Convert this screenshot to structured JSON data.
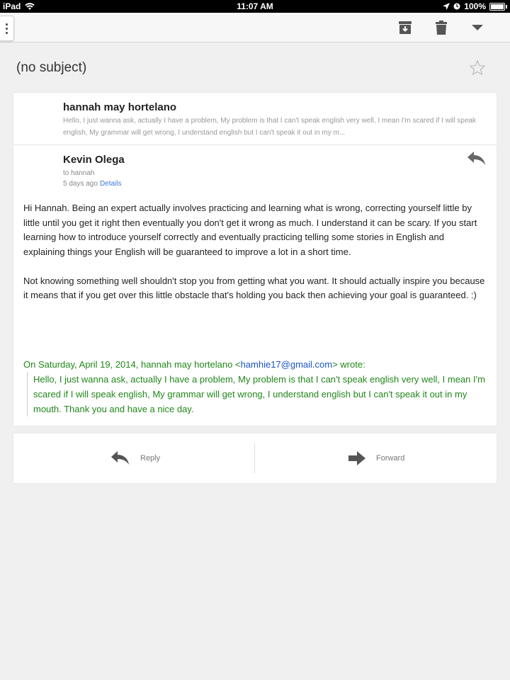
{
  "status_bar": {
    "device": "iPad",
    "time": "11:07 AM",
    "battery": "100%"
  },
  "toolbar": {
    "icons": [
      "menu-dots-icon",
      "archive-icon",
      "trash-icon",
      "chevron-down-icon"
    ]
  },
  "subject": "(no subject)",
  "thread": {
    "collapsed_message": {
      "sender": "hannah may hortelano",
      "snippet": "Hello, I just wanna ask, actually I have a problem, My problem is that I can't speak english very well, I mean I'm scared if I will speak english, My grammar will get wrong, I understand english but I can't speak it out in my m..."
    },
    "expanded_message": {
      "sender": "Kevin Olega",
      "to": "to hannah",
      "date": "5 days ago",
      "details_link": "Details",
      "body_p1": "Hi Hannah. Being an expert actually involves practicing and learning what is wrong, correcting yourself little by little until you get it right then eventually you don't get it wrong as much. I understand it can be scary. If you start learning how to introduce yourself correctly and eventually practicing telling some stories in English and explaining things your English will be guaranteed to improve a lot in a short time.",
      "body_p2": "Not knowing something well shouldn't stop you from getting what you want. It should actually inspire you because it means that if you get over this little obstacle that's holding you back then achieving your goal is guaranteed. :)",
      "quote_prefix": "On Saturday, April 19, 2014, hannah may hortelano <",
      "quote_email": "hamhie17@gmail.com",
      "quote_suffix": "> wrote:",
      "quote_body": "Hello, I just wanna ask, actually I have a problem, My problem is that I can't speak english very well, I mean I'm scared if I will speak english, My grammar will get wrong, I understand english but I can't speak it out in my mouth. Thank you and have a nice day."
    }
  },
  "actions": {
    "reply_label": "Reply",
    "forward_label": "Forward"
  },
  "colors": {
    "quote_green": "#21871a",
    "link_blue": "#3c78d8"
  }
}
